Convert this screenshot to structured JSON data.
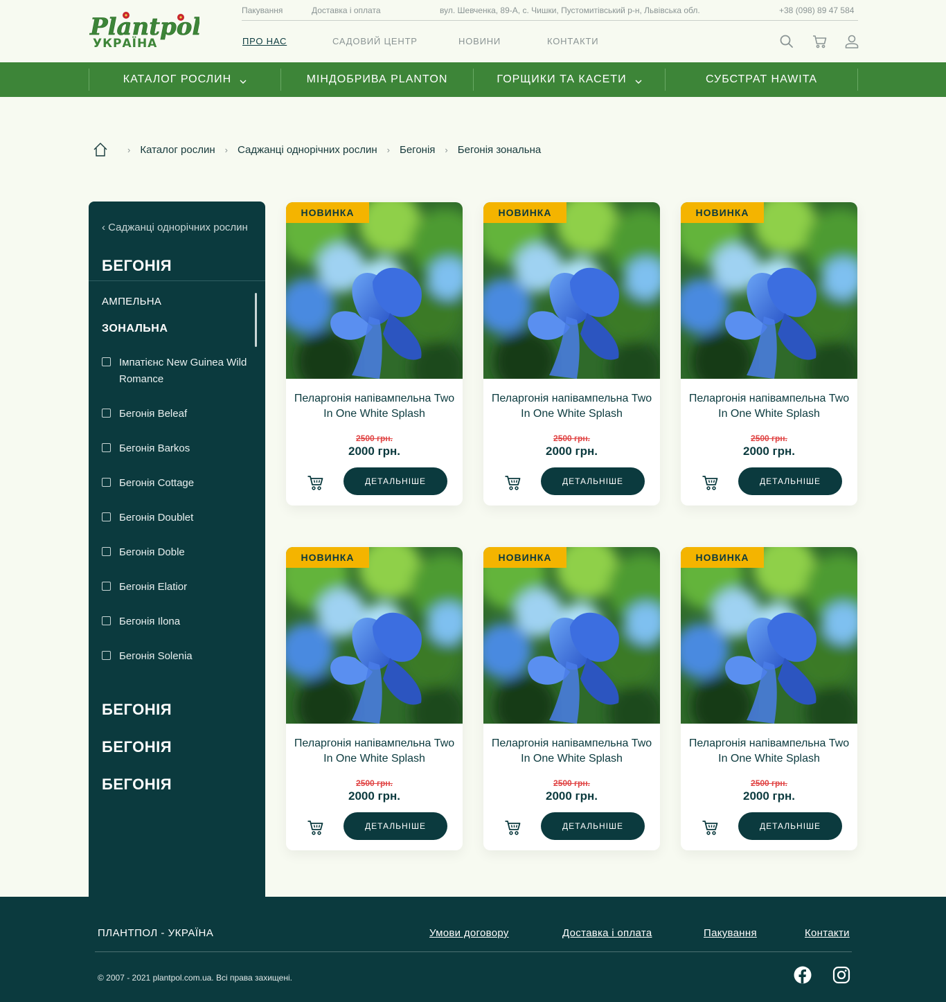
{
  "colors": {
    "brand_green": "#3d8538",
    "dark_teal": "#0b3a3e",
    "badge_yellow": "#f4b400",
    "old_price_red": "#e04444",
    "page_bg": "#f7faf1"
  },
  "logo": {
    "line1": "Plantpol",
    "line2": "УКРАЇНА"
  },
  "topbar": {
    "packaging": "Пакування",
    "delivery": "Доставка і оплата",
    "address": "вул. Шевченка, 89-А, с. Чишки, Пустомитівський р-н, Львівська обл.",
    "phone": "+38 (098) 89 47 584"
  },
  "mainnav": [
    {
      "label": "ПРО НАС",
      "active": true
    },
    {
      "label": "САДОВИЙ ЦЕНТР"
    },
    {
      "label": "НОВИНИ"
    },
    {
      "label": "КОНТАКТИ"
    }
  ],
  "header_icons": [
    "search-icon",
    "cart-icon",
    "user-icon"
  ],
  "greennav": [
    {
      "label": "КАТАЛОГ РОСЛИН",
      "dropdown": true
    },
    {
      "label": "МІНДОБРИВА PLANTON",
      "dropdown": false
    },
    {
      "label": "ГОРЩИКИ ТА КАСЕТИ",
      "dropdown": true
    },
    {
      "label": "СУБСТРАТ HAWITA",
      "dropdown": false
    }
  ],
  "breadcrumb": [
    "Каталог рослин",
    "Саджанці однорічних рослин",
    "Бегонія",
    "Бегонія зональна"
  ],
  "sidebar": {
    "back": "‹ Саджанці однорічних рослин",
    "title": "БЕГОНІЯ",
    "subcategories": [
      "АМПЕЛЬНА",
      "ЗОНАЛЬНА"
    ],
    "filters": [
      "Імпатієнс New Guinea Wild Romance",
      "Бегонія Beleaf",
      "Бегонія Barkos",
      "Бегонія Cottage",
      "Бегонія Doublet",
      "Бегонія Doble",
      "Бегонія Elatior",
      "Бегонія Ilona",
      "Бегонія Solenia"
    ],
    "groups": [
      "БЕГОНІЯ",
      "БЕГОНІЯ",
      "БЕГОНІЯ"
    ]
  },
  "products": [
    {
      "badge": "НОВИНКА",
      "name": "Пеларгонія напівампельна Two In One White Splash",
      "old_price": "2500 грн.",
      "price": "2000 грн.",
      "button": "ДЕТАЛЬНІШЕ"
    },
    {
      "badge": "НОВИНКА",
      "name": "Пеларгонія напівампельна Two In One White Splash",
      "old_price": "2500 грн.",
      "price": "2000 грн.",
      "button": "ДЕТАЛЬНІШЕ"
    },
    {
      "badge": "НОВИНКА",
      "name": "Пеларгонія напівампельна Two In One White Splash",
      "old_price": "2500 грн.",
      "price": "2000 грн.",
      "button": "ДЕТАЛЬНІШЕ"
    },
    {
      "badge": "НОВИНКА",
      "name": "Пеларгонія напівампельна Two In One White Splash",
      "old_price": "2500 грн.",
      "price": "2000 грн.",
      "button": "ДЕТАЛЬНІШЕ"
    },
    {
      "badge": "НОВИНКА",
      "name": "Пеларгонія напівампельна Two In One White Splash",
      "old_price": "2500 грн.",
      "price": "2000 грн.",
      "button": "ДЕТАЛЬНІШЕ"
    },
    {
      "badge": "НОВИНКА",
      "name": "Пеларгонія напівампельна Two In One White Splash",
      "old_price": "2500 грн.",
      "price": "2000 грн.",
      "button": "ДЕТАЛЬНІШЕ"
    }
  ],
  "footer": {
    "brand": "ПЛАНТПОЛ - УКРАЇНА",
    "links": [
      "Умови договору",
      "Доставка і оплата",
      "Пакування",
      "Контакти"
    ],
    "copyright": "© 2007 - 2021 plantpol.com.ua. Всі права захищені.",
    "social": [
      "facebook-icon",
      "instagram-icon"
    ]
  }
}
